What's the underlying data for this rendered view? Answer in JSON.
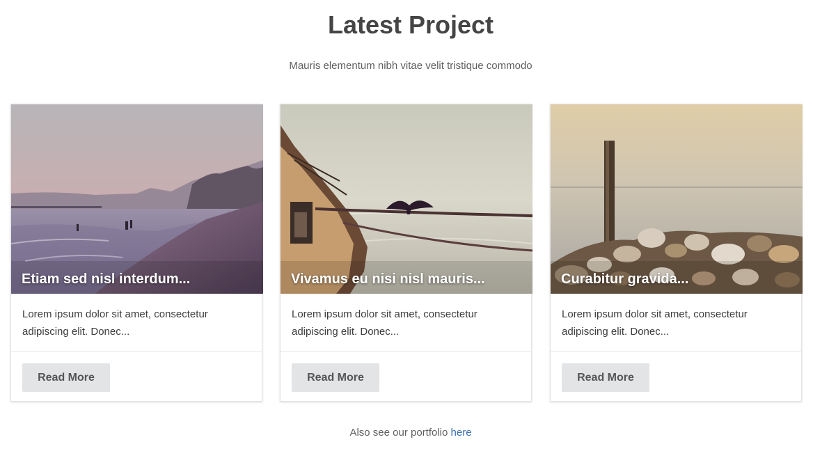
{
  "section": {
    "title": "Latest Project",
    "subtitle": "Mauris elementum nibh vitae velit tristique commodo"
  },
  "cards": [
    {
      "title": "Etiam sed nisl interdum...",
      "text": "Lorem ipsum dolor sit amet, consectetur adipiscing elit. Donec...",
      "button_label": "Read More"
    },
    {
      "title": "Vivamus eu nisi nisl mauris...",
      "text": "Lorem ipsum dolor sit amet, consectetur adipiscing elit. Donec...",
      "button_label": "Read More"
    },
    {
      "title": "Curabitur gravida...",
      "text": "Lorem ipsum dolor sit amet, consectetur adipiscing elit. Donec...",
      "button_label": "Read More"
    }
  ],
  "footer": {
    "text": "Also see our portfolio ",
    "link_label": "here"
  },
  "colors": {
    "link": "#3b6fb0",
    "button_bg": "#e3e4e6",
    "title": "#454545"
  }
}
